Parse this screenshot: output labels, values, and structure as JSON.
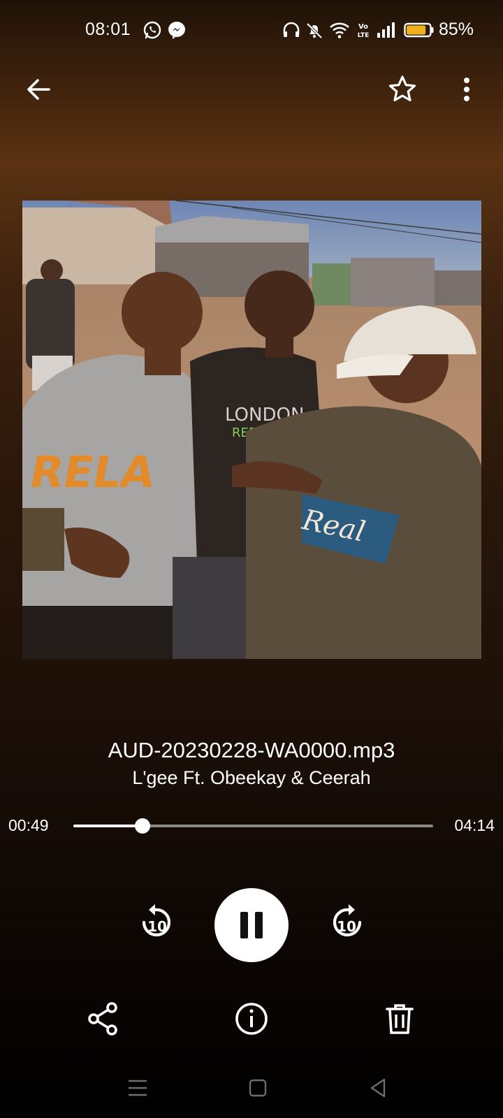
{
  "status_bar": {
    "time": "08:01",
    "notification_icons": [
      "whatsapp-icon",
      "messenger-icon"
    ],
    "system_icons": [
      "headphones-icon",
      "mute-bell-icon",
      "wifi-icon",
      "volte-icon",
      "signal-icon",
      "battery-icon"
    ],
    "battery_percent": "85%",
    "battery_level": 0.85,
    "battery_color": "#f0b020"
  },
  "top_bar": {
    "back_icon": "arrow-left-icon",
    "favorite_icon": "star-outline-icon",
    "menu_icon": "more-vert-icon"
  },
  "track": {
    "title": "AUD-20230228-WA0000.mp3",
    "artist": "L'gee Ft. Obeekay & Ceerah"
  },
  "progress": {
    "elapsed": "00:49",
    "duration": "04:14",
    "fraction": 0.1929
  },
  "controls": {
    "rewind_seconds": "10",
    "forward_seconds": "10",
    "state": "playing"
  },
  "actions": [
    "share-icon",
    "info-icon",
    "delete-icon"
  ],
  "navigation_bar": [
    "recents-icon",
    "home-icon",
    "back-icon"
  ],
  "colors": {
    "accent": "#ffffff",
    "seek_track": "#8b8782"
  }
}
